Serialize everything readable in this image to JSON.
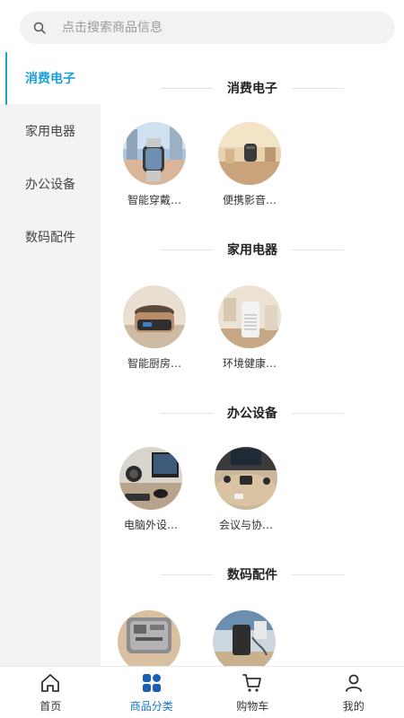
{
  "search": {
    "placeholder": "点击搜索商品信息"
  },
  "sidebar": {
    "items": [
      {
        "label": "消费电子",
        "active": true
      },
      {
        "label": "家用电器",
        "active": false
      },
      {
        "label": "办公设备",
        "active": false
      },
      {
        "label": "数码配件",
        "active": false
      }
    ]
  },
  "sections": [
    {
      "title": "消费电子",
      "products": [
        {
          "name": "智能穿戴…",
          "icon": "smartwatch-photo"
        },
        {
          "name": "便携影音…",
          "icon": "speaker-photo"
        }
      ]
    },
    {
      "title": "家用电器",
      "products": [
        {
          "name": "智能厨房…",
          "icon": "rice-cooker-photo"
        },
        {
          "name": "环境健康…",
          "icon": "air-purifier-photo"
        }
      ]
    },
    {
      "title": "办公设备",
      "products": [
        {
          "name": "电脑外设…",
          "icon": "computer-peripherals-photo"
        },
        {
          "name": "会议与协…",
          "icon": "conference-photo"
        }
      ]
    },
    {
      "title": "数码配件",
      "products": [
        {
          "name": "",
          "icon": "accessory-bag-photo"
        },
        {
          "name": "",
          "icon": "power-bank-photo"
        }
      ]
    }
  ],
  "tabbar": {
    "tabs": [
      {
        "label": "首页",
        "icon": "home-icon",
        "active": false
      },
      {
        "label": "商品分类",
        "icon": "category-icon",
        "active": true
      },
      {
        "label": "购物车",
        "icon": "cart-icon",
        "active": false
      },
      {
        "label": "我的",
        "icon": "user-icon",
        "active": false
      }
    ]
  },
  "colors": {
    "accent": "#1aa0d8",
    "tab_active": "#1a73c8",
    "sidebar_bg": "#f3f3f3"
  }
}
